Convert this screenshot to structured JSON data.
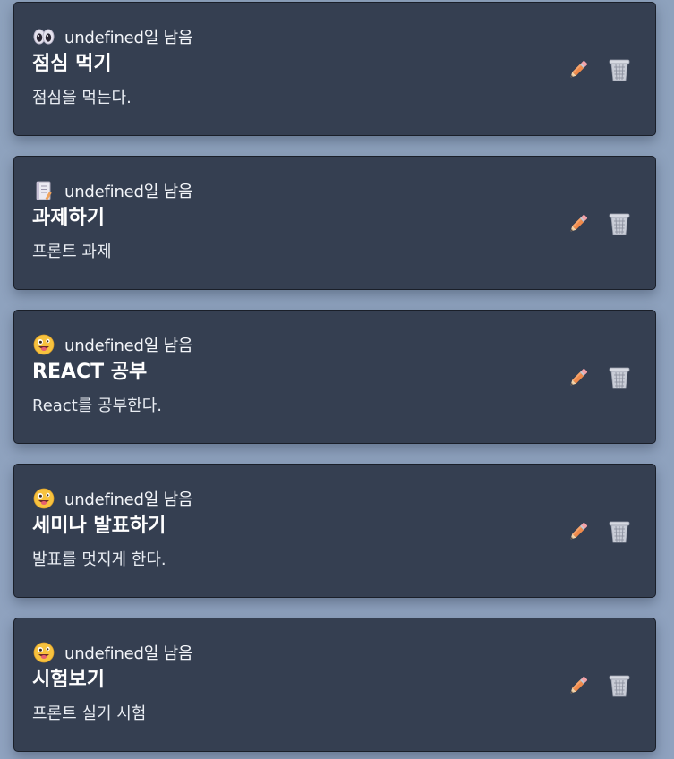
{
  "todos": [
    {
      "emoji": "eyes-icon",
      "remaining_text": "undefined일 남음",
      "title": "점심 먹기",
      "description": "점심을 먹는다."
    },
    {
      "emoji": "notebook-icon",
      "remaining_text": "undefined일 남음",
      "title": "과제하기",
      "description": "프론트 과제"
    },
    {
      "emoji": "zany-face-icon",
      "remaining_text": "undefined일 남음",
      "title": "REACT 공부",
      "description": "React를 공부한다."
    },
    {
      "emoji": "zany-face-icon",
      "remaining_text": "undefined일 남음",
      "title": "세미나 발표하기",
      "description": "발표를 멋지게 한다."
    },
    {
      "emoji": "zany-face-icon",
      "remaining_text": "undefined일 남음",
      "title": "시험보기",
      "description": "프론트 실기 시험"
    }
  ],
  "actions": {
    "edit_icon": "pencil-icon",
    "delete_icon": "trash-icon"
  },
  "colors": {
    "background": "#8fa2bf",
    "card": "#353f51",
    "card_border": "#1a1f29",
    "text": "#ffffff",
    "pencil": "#f08a4b",
    "trash": "#c8ccd6"
  }
}
